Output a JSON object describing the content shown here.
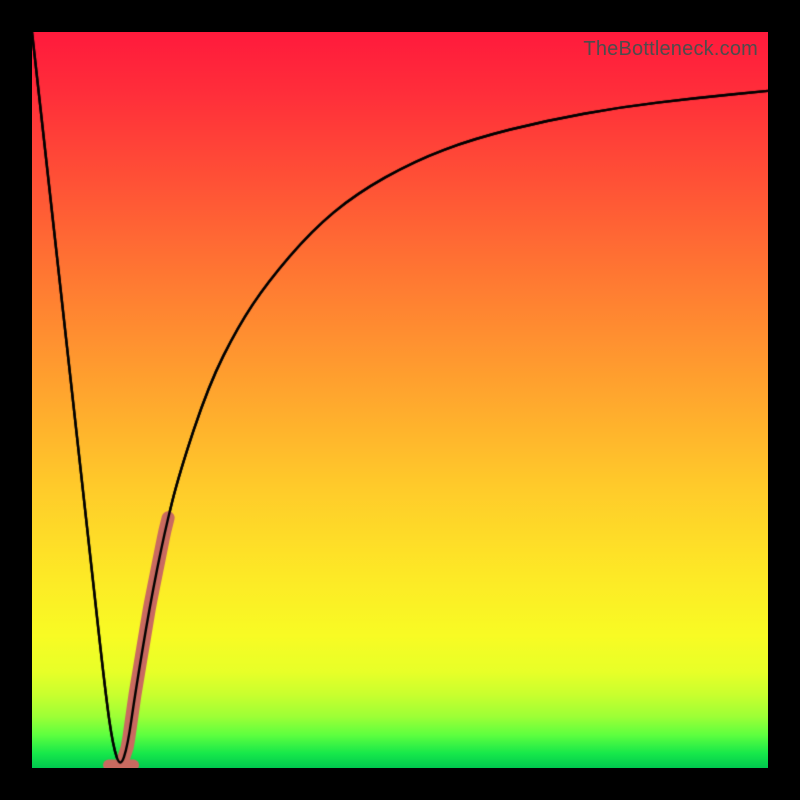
{
  "attribution": "TheBottleneck.com",
  "colors": {
    "frame": "#000000",
    "curve": "#000000",
    "highlight": "#c96a60",
    "attribution_text": "#4d4d4d"
  },
  "chart_data": {
    "type": "line",
    "title": "",
    "xlabel": "",
    "ylabel": "",
    "xlim": [
      0,
      100
    ],
    "ylim": [
      0,
      100
    ],
    "series": [
      {
        "name": "bottleneck-curve",
        "x": [
          0,
          2,
          4,
          6,
          8,
          10,
          11,
          12,
          13,
          14,
          16,
          18,
          20,
          24,
          28,
          32,
          38,
          44,
          52,
          60,
          70,
          80,
          90,
          100
        ],
        "y": [
          100,
          82,
          64,
          46,
          28,
          10,
          3,
          0,
          3,
          10,
          22,
          32,
          40,
          52,
          60,
          66,
          73,
          78,
          82.5,
          85.5,
          88,
          89.8,
          91,
          92
        ]
      }
    ],
    "highlight": {
      "start_x": 12.5,
      "end_x": 18.5,
      "note": "thick salmon segment along rising part of curve"
    },
    "minimum": {
      "x": 12,
      "y": 0
    }
  }
}
